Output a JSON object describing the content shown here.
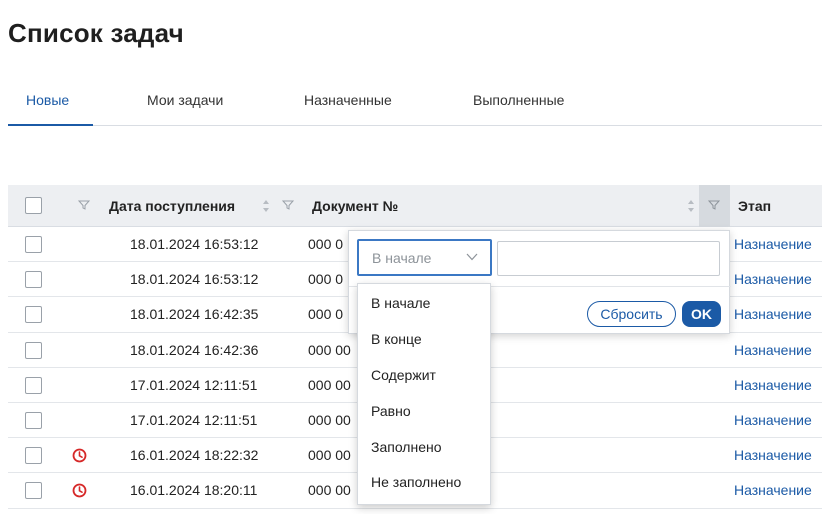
{
  "page": {
    "title": "Список задач"
  },
  "tabs": [
    {
      "label": "Новые",
      "active": true
    },
    {
      "label": "Мои задачи",
      "active": false
    },
    {
      "label": "Назначенные",
      "active": false
    },
    {
      "label": "Выполненные",
      "active": false
    }
  ],
  "table": {
    "columns": {
      "date": "Дата поступления",
      "document": "Документ №",
      "stage": "Этап"
    },
    "rows": [
      {
        "date": "18.01.2024 16:53:12",
        "document": "000 0",
        "stage": "Назначение",
        "overdue": false
      },
      {
        "date": "18.01.2024 16:53:12",
        "document": "000 0",
        "stage": "Назначение",
        "overdue": false
      },
      {
        "date": "18.01.2024 16:42:35",
        "document": "000 0",
        "stage": "Назначение",
        "overdue": false
      },
      {
        "date": "18.01.2024 16:42:36",
        "document": "000 00",
        "stage": "Назначение",
        "overdue": false
      },
      {
        "date": "17.01.2024 12:11:51",
        "document": "000 00",
        "stage": "Назначение",
        "overdue": false
      },
      {
        "date": "17.01.2024 12:11:51",
        "document": "000 00",
        "stage": "Назначение",
        "overdue": false
      },
      {
        "date": "16.01.2024 18:22:32",
        "document": "000 00",
        "stage": "Назначение",
        "overdue": true
      },
      {
        "date": "16.01.2024 18:20:11",
        "document": "000 00",
        "stage": "Назначение",
        "overdue": true
      }
    ]
  },
  "filter_popup": {
    "selected_condition": "В начале",
    "value": "",
    "reset_label": "Сбросить",
    "ok_label": "OK",
    "options": [
      "В начале",
      "В конце",
      "Содержит",
      "Равно",
      "Заполнено",
      "Не заполнено"
    ]
  },
  "colors": {
    "accent": "#1b5aa6",
    "overdue": "#d62828",
    "header_bg": "#edeff2"
  }
}
